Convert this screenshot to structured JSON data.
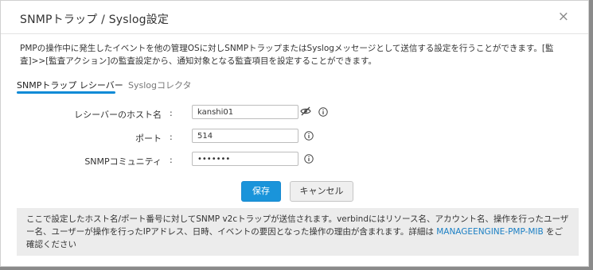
{
  "dialog": {
    "title": "SNMPトラップ / Syslog設定",
    "close_glyph": "×",
    "description": "PMPの操作中に発生したイベントを他の管理OSに対しSNMPトラップまたはSyslogメッセージとして送信する設定を行うことができます。[監査]>>[監査アクション]の監査設定から、通知対象となる監査項目を設定することができます。"
  },
  "tabs": [
    {
      "label": "SNMPトラップ レシーバー",
      "active": true
    },
    {
      "label": "Syslogコレクタ",
      "active": false
    }
  ],
  "form": {
    "colon": ":",
    "host": {
      "label": "レシーバーのホスト名",
      "value": "kanshi01"
    },
    "port": {
      "label": "ポート",
      "value": "514"
    },
    "community": {
      "label": "SNMPコミュニティ",
      "value": "•••••••"
    }
  },
  "buttons": {
    "save": "保存",
    "cancel": "キャンセル"
  },
  "note": {
    "text_before_link": "ここで設定したホスト名/ポート番号に対してSNMP v2cトラップが送信されます。verbindにはリソース名、アカウント名、操作を行ったユーザー名、ユーザーが操作を行ったIPアドレス、日時、イベントの要因となった操作の理由が含まれます。詳細は ",
    "link_text": "MANAGEENGINE-PMP-MIB",
    "text_after_link": " をご確認ください"
  },
  "colors": {
    "accent": "#1a94da",
    "tab_underline": "#0b8ad6",
    "link": "#1a7fc4",
    "note_bg": "#ececec"
  },
  "icons": [
    "close-icon",
    "eye-slash-icon",
    "info-icon"
  ]
}
